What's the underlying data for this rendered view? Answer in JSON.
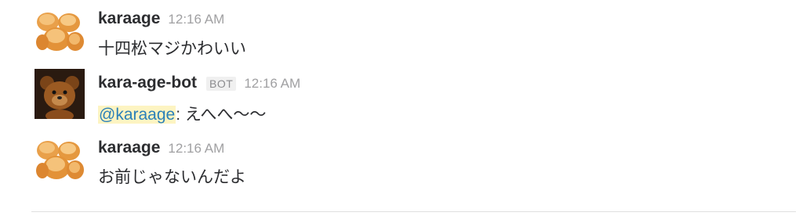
{
  "messages": [
    {
      "user": "karaage",
      "time": "12:16 AM",
      "text": "十四松マジかわいい",
      "avatar": "karaage-icon"
    },
    {
      "user": "kara-age-bot",
      "badge": "BOT",
      "time": "12:16 AM",
      "mention": "@karaage",
      "text": ": えへへ〜〜",
      "avatar": "teddy-bear-icon"
    },
    {
      "user": "karaage",
      "time": "12:16 AM",
      "text": "お前じゃないんだよ",
      "avatar": "karaage-icon"
    }
  ],
  "colors": {
    "mention": "#2a80b9",
    "mention_bg": "#fdf4c2",
    "timestamp": "#a0a0a2"
  }
}
